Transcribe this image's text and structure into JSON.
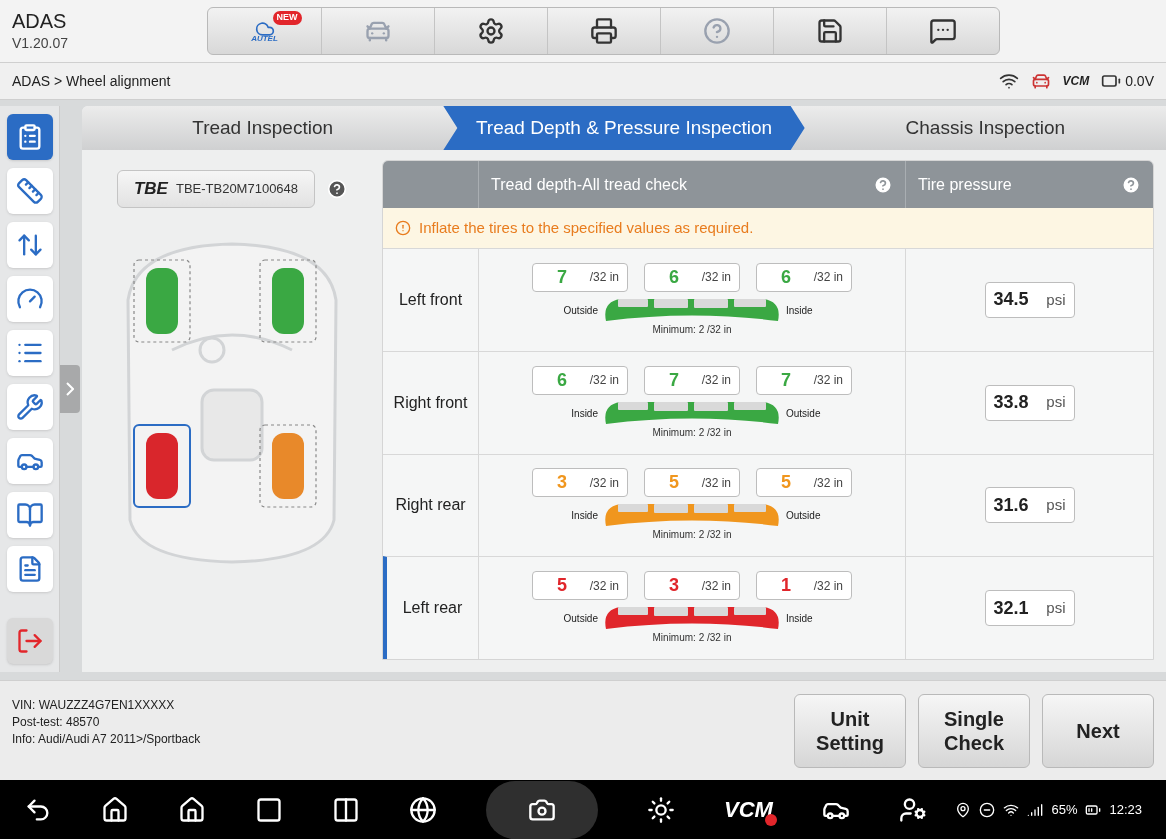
{
  "header": {
    "title": "ADAS",
    "version": "V1.20.07"
  },
  "toolbar": [
    {
      "kind": "autel",
      "label": "AUTEL",
      "badge": "NEW",
      "disabled": false
    },
    {
      "kind": "lift",
      "disabled": true
    },
    {
      "kind": "settings",
      "disabled": false
    },
    {
      "kind": "print",
      "disabled": false
    },
    {
      "kind": "help",
      "disabled": true
    },
    {
      "kind": "save",
      "disabled": false
    },
    {
      "kind": "message",
      "disabled": false
    }
  ],
  "breadcrumb": "ADAS > Wheel alignment",
  "status": {
    "vcm": "VCM",
    "voltage": "0.0V"
  },
  "sidebar": [
    {
      "kind": "report",
      "selected": true
    },
    {
      "kind": "ruler",
      "selected": false
    },
    {
      "kind": "axle",
      "selected": false
    },
    {
      "kind": "steering",
      "selected": false
    },
    {
      "kind": "list",
      "selected": false
    },
    {
      "kind": "tools",
      "selected": false
    },
    {
      "kind": "car",
      "selected": false
    },
    {
      "kind": "manual",
      "selected": false
    },
    {
      "kind": "document",
      "selected": false
    },
    {
      "kind": "exit",
      "selected": false
    }
  ],
  "tabs": [
    {
      "label": "Tread Inspection",
      "selected": false
    },
    {
      "label": "Tread Depth & Pressure Inspection",
      "selected": true
    },
    {
      "label": "Chassis Inspection",
      "selected": false
    }
  ],
  "sensor": {
    "logo": "TBE",
    "serial": "TBE-TB20M7100648"
  },
  "car_diagram": {
    "tires": [
      {
        "color": "#3aa843",
        "selected": false
      },
      {
        "color": "#3aa843",
        "selected": false
      },
      {
        "color": "#d9262c",
        "selected": true
      },
      {
        "color": "#e8892a",
        "selected": false
      }
    ]
  },
  "table": {
    "columns": [
      {
        "label": "Tread depth-All tread check"
      },
      {
        "label": "Tire pressure"
      }
    ],
    "warning": "Inflate the tires to the specified values as required.",
    "rows": [
      {
        "label": "Left front",
        "selected": false,
        "color": "#3aa843",
        "readings": [
          {
            "value": "7",
            "unit": "/32 in"
          },
          {
            "value": "6",
            "unit": "/32 in"
          },
          {
            "value": "6",
            "unit": "/32 in"
          }
        ],
        "left_side": "Outside",
        "right_side": "Inside",
        "minimum": "Minimum: 2 /32 in",
        "pressure": "34.5",
        "pressure_unit": "psi"
      },
      {
        "label": "Right front",
        "selected": false,
        "color": "#3aa843",
        "readings": [
          {
            "value": "6",
            "unit": "/32 in"
          },
          {
            "value": "7",
            "unit": "/32 in"
          },
          {
            "value": "7",
            "unit": "/32 in"
          }
        ],
        "left_side": "Inside",
        "right_side": "Outside",
        "minimum": "Minimum: 2 /32 in",
        "pressure": "33.8",
        "pressure_unit": "psi"
      },
      {
        "label": "Right rear",
        "selected": false,
        "color": "#f0961e",
        "readings": [
          {
            "value": "3",
            "unit": "/32 in"
          },
          {
            "value": "5",
            "unit": "/32 in"
          },
          {
            "value": "5",
            "unit": "/32 in"
          }
        ],
        "left_side": "Inside",
        "right_side": "Outside",
        "minimum": "Minimum: 2 /32 in",
        "pressure": "31.6",
        "pressure_unit": "psi"
      },
      {
        "label": "Left rear",
        "selected": true,
        "color": "#e0262b",
        "readings": [
          {
            "value": "5",
            "unit": "/32 in"
          },
          {
            "value": "3",
            "unit": "/32 in"
          },
          {
            "value": "1",
            "unit": "/32 in"
          }
        ],
        "left_side": "Outside",
        "right_side": "Inside",
        "minimum": "Minimum: 2 /32 in",
        "pressure": "32.1",
        "pressure_unit": "psi"
      }
    ]
  },
  "vehicle_info": [
    "VIN: WAUZZZ4G7EN1XXXXX",
    "Post-test: 48570",
    "Info: Audi/Audi A7 2011>/Sportback"
  ],
  "actions": [
    {
      "label": "Unit Setting"
    },
    {
      "label": "Single Check"
    },
    {
      "label": "Next"
    }
  ],
  "navbar": {
    "items": [
      {
        "kind": "back"
      },
      {
        "kind": "home"
      },
      {
        "kind": "android"
      },
      {
        "kind": "recent"
      },
      {
        "kind": "split"
      },
      {
        "kind": "browser"
      },
      {
        "kind": "camera"
      },
      {
        "kind": "brightness"
      },
      {
        "kind": "vcm",
        "label": "VCM"
      },
      {
        "kind": "car-check"
      },
      {
        "kind": "mechanic"
      }
    ],
    "battery": "65%",
    "time": "12:23"
  }
}
